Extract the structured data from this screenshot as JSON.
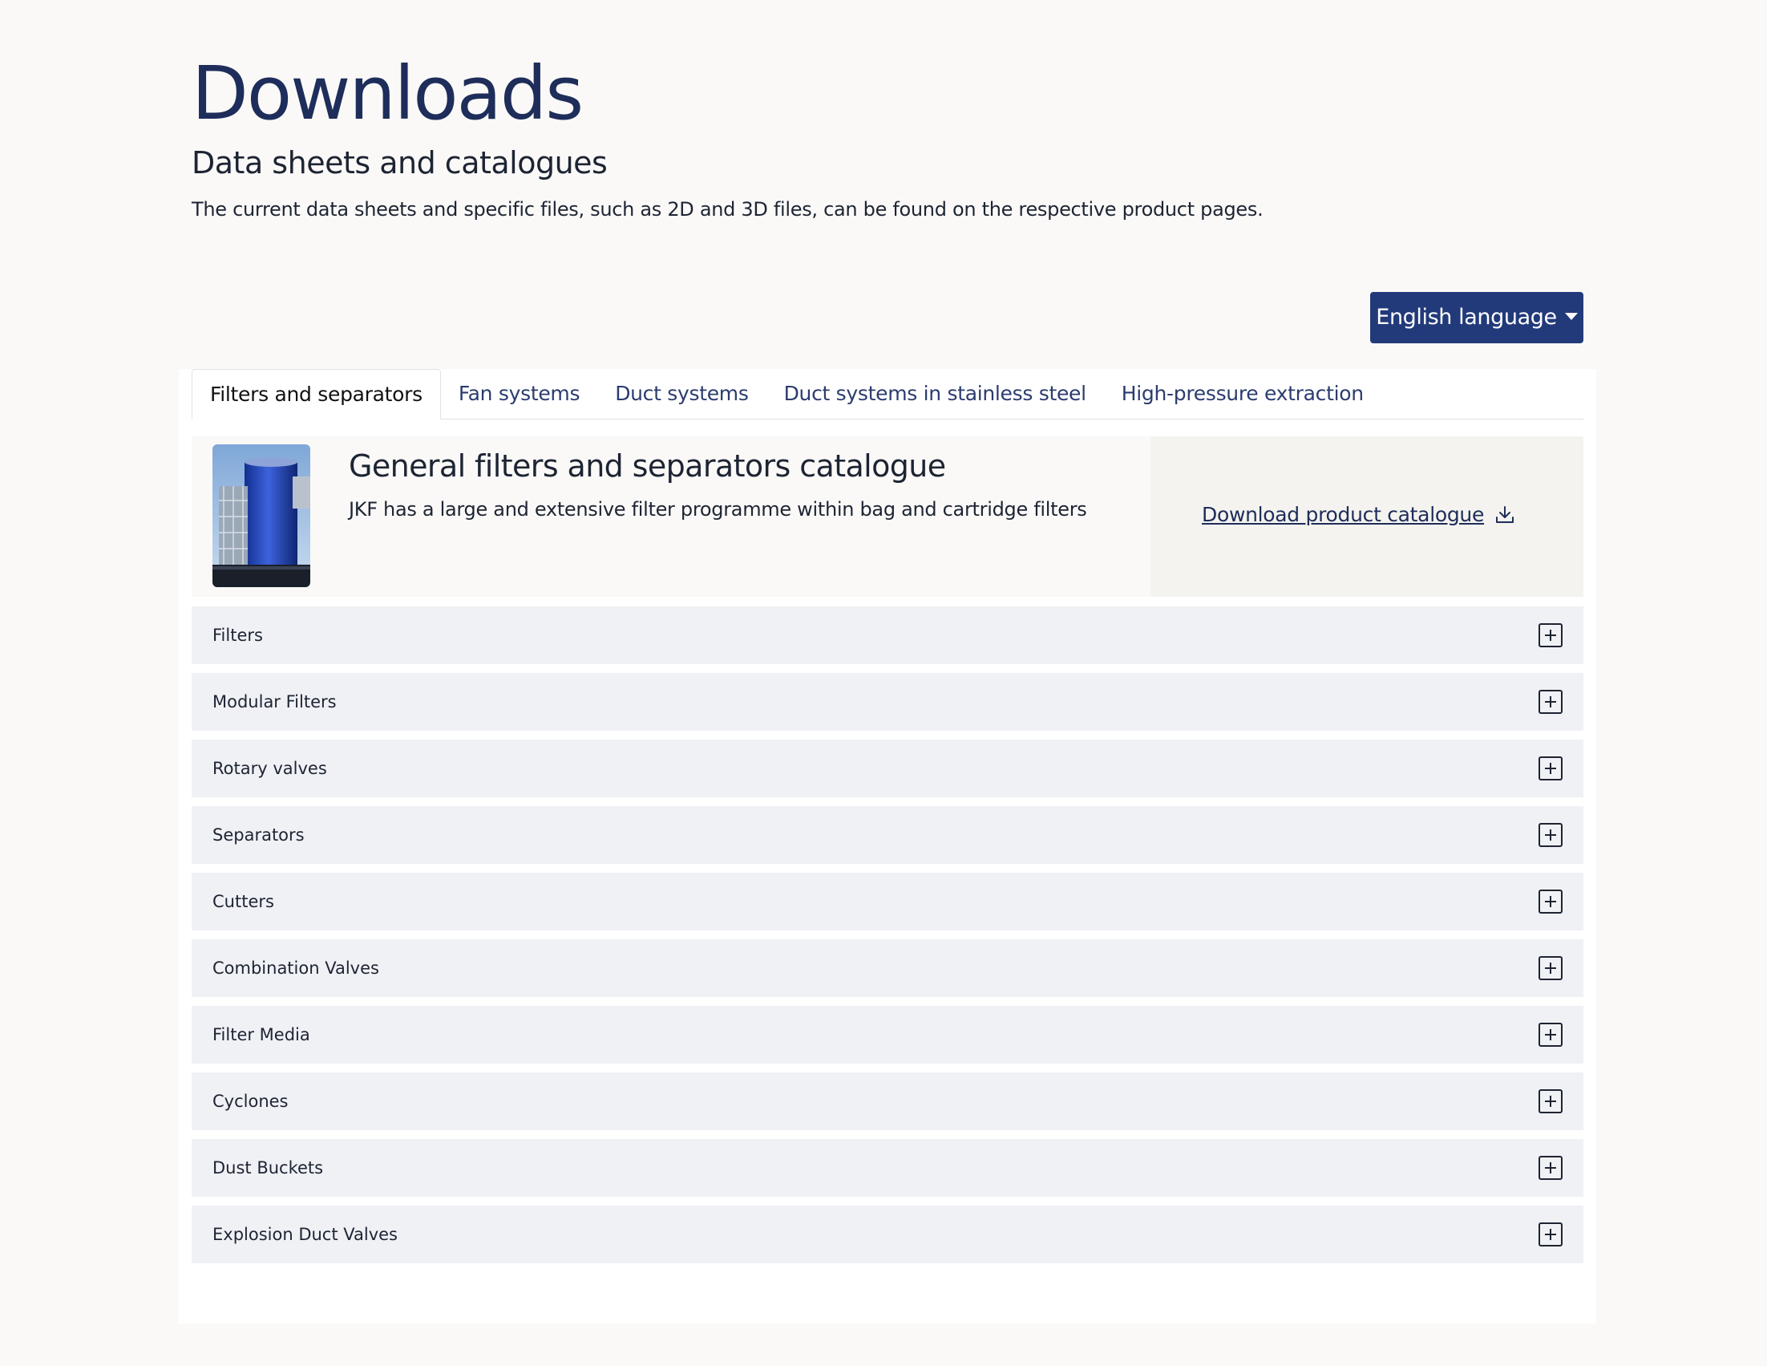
{
  "header": {
    "title": "Downloads",
    "subtitle": "Data sheets and catalogues",
    "intro": "The current data sheets and specific files, such as 2D and 3D files, can be found on the respective product pages."
  },
  "language_selector": {
    "label": "English language",
    "icon": "caret-down-icon"
  },
  "tabs": [
    {
      "label": "Filters and separators",
      "active": true
    },
    {
      "label": "Fan systems",
      "active": false
    },
    {
      "label": "Duct systems",
      "active": false
    },
    {
      "label": "Duct systems in stainless steel",
      "active": false
    },
    {
      "label": "High-pressure extraction",
      "active": false
    }
  ],
  "catalogue": {
    "title": "General filters and separators catalogue",
    "description": "JKF has a large and extensive filter programme within bag and cartridge filters",
    "download_label": "Download product catalogue",
    "download_icon": "download-icon"
  },
  "accordion": {
    "expand_icon": "plus-square-icon",
    "items": [
      "Filters",
      "Modular Filters",
      "Rotary valves",
      "Separators",
      "Cutters",
      "Combination Valves",
      "Filter Media",
      "Cyclones",
      "Dust Buckets",
      "Explosion Duct Valves"
    ]
  },
  "colors": {
    "brand_navy": "#1e2d5a",
    "button_blue": "#223a7a",
    "page_bg": "#faf9f7",
    "accordion_bg": "#f0f1f5"
  }
}
